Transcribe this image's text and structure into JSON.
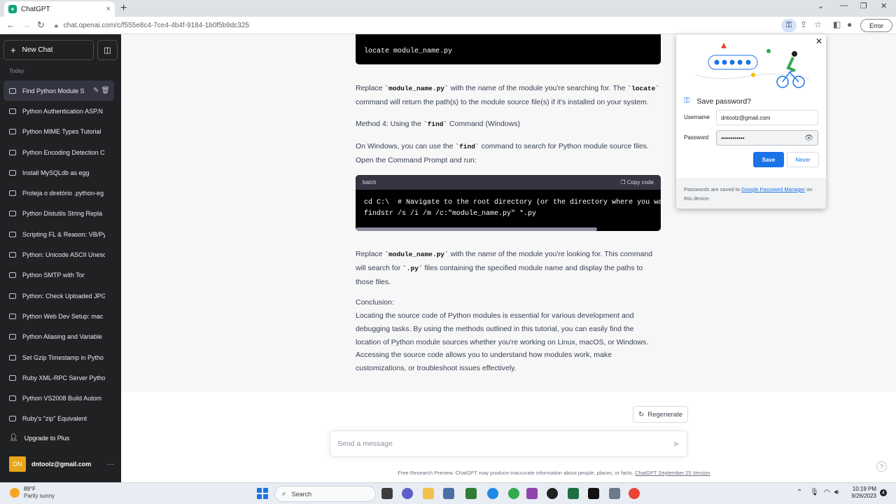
{
  "browser": {
    "tab_title": "ChatGPT",
    "tab_close": "×",
    "new_tab": "+",
    "url": "chat.openai.com/c/f555e8c4-7ce4-4b4f-9184-1b0f5b9dc325",
    "error_label": "Error"
  },
  "sidebar": {
    "new_chat": "New Chat",
    "section_today": "Today",
    "items": [
      {
        "label": "Find Python Module S"
      },
      {
        "label": "Python Authentication ASP.N"
      },
      {
        "label": "Python MIME Types Tutorial"
      },
      {
        "label": "Python Encoding Detection C"
      },
      {
        "label": "Install MySQLdb as egg"
      },
      {
        "label": "Proteja o diretório .python-eg"
      },
      {
        "label": "Python Distutils String Repla"
      },
      {
        "label": "Scripting FL & Reason: VB/Py"
      },
      {
        "label": "Python: Unicode ASCII Unesc"
      },
      {
        "label": "Python SMTP with Tor"
      },
      {
        "label": "Python: Check Uploaded JPG"
      },
      {
        "label": "Python Web Dev Setup: mac"
      },
      {
        "label": "Python Aliasing and Variable"
      },
      {
        "label": "Set Gzip Timestamp in Pytho"
      },
      {
        "label": "Ruby XML-RPC Server Pytho"
      },
      {
        "label": "Python VS2008 Build Autom"
      },
      {
        "label": "Ruby's \"zip\" Equivalent"
      }
    ],
    "upgrade": "Upgrade to Plus",
    "avatar_initials": "DN",
    "account_email": "dntoolz@gmail.com",
    "account_menu": "···"
  },
  "conversation": {
    "code1_line": "locate module_name.py",
    "p1_a": "Replace ",
    "p1_code": "`module_name.py`",
    "p1_b": " with the name of the module you're searching for. The ",
    "p1_code2": "`locate`",
    "p1_c": " command will return the path(s) to the module source file(s) if it's installed on your system.",
    "method4_a": "Method 4: Using the ",
    "method4_code": "`find`",
    "method4_b": " Command (Windows)",
    "p2_a": "On Windows, you can use the ",
    "p2_code": "`find`",
    "p2_b": " command to search for Python module source files. Open the Command Prompt and run:",
    "code2_lang": "batch",
    "code2_copy": "Copy code",
    "code2_line1": "cd C:\\  # Navigate to the root directory (or the directory where you want to",
    "code2_line2": "findstr /s /i /m /c:\"module_name.py\" *.py",
    "p3_a": "Replace ",
    "p3_code": "`module_name.py`",
    "p3_b": " with the name of the module you're looking for. This command will search for ",
    "p3_code2": "`.py`",
    "p3_c": " files containing the specified module name and display the paths to those files.",
    "conclusion_head": "Conclusion:",
    "conclusion_body": "Locating the source code of Python modules is essential for various development and debugging tasks. By using the methods outlined in this tutorial, you can easily find the location of Python module sources whether you're working on Linux, macOS, or Windows. Accessing the source code allows you to understand how modules work, make customizations, or troubleshoot issues effectively."
  },
  "composer": {
    "regenerate": "Regenerate",
    "placeholder": "Send a message",
    "footer_text": "Free Research Preview. ChatGPT may produce inaccurate information about people, places, or facts. ",
    "footer_link": "ChatGPT September 25 Version",
    "help": "?"
  },
  "password_popup": {
    "title": "Save password?",
    "username_label": "Username",
    "username_value": "dntoolz@gmail.com",
    "password_label": "Password",
    "password_value": "••••••••••••",
    "save": "Save",
    "never": "Never",
    "foot_a": "Passwords are saved to ",
    "foot_link": "Google Password Manager",
    "foot_b": " on this device."
  },
  "taskbar": {
    "temp": "89°F",
    "weather": "Partly sunny",
    "search": "Search",
    "time": "10:19 PM",
    "date": "9/26/2023",
    "notifications": "4"
  },
  "colors": {
    "sidebar_bg": "#202123",
    "accent_blue": "#1a73e8",
    "avatar": "#e8a517"
  }
}
